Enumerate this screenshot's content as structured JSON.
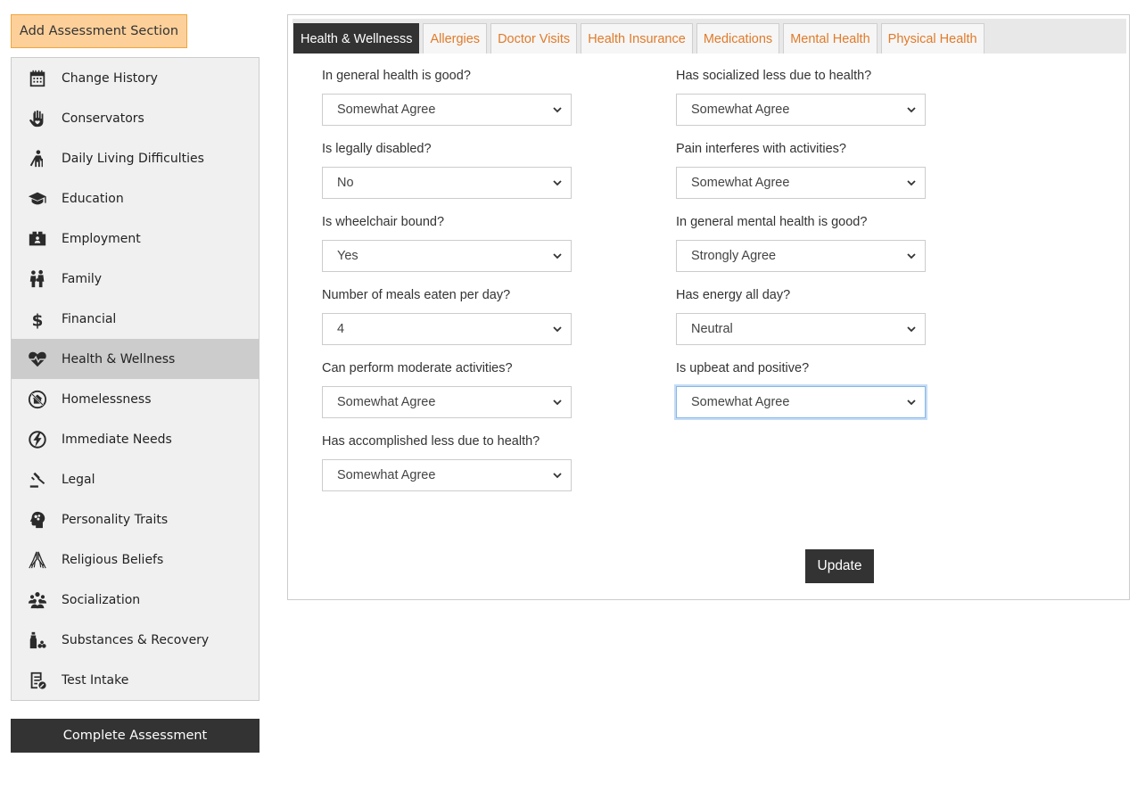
{
  "sidebar": {
    "add_section_label": "Add Assessment Section",
    "items": [
      {
        "label": "Change History",
        "icon": "calendar-icon"
      },
      {
        "label": "Conservators",
        "icon": "hand-heart-icon"
      },
      {
        "label": "Daily Living Difficulties",
        "icon": "person-cane-icon"
      },
      {
        "label": "Education",
        "icon": "graduation-cap-icon"
      },
      {
        "label": "Employment",
        "icon": "id-badge-icon"
      },
      {
        "label": "Family",
        "icon": "family-icon"
      },
      {
        "label": "Financial",
        "icon": "dollar-icon"
      },
      {
        "label": "Health & Wellness",
        "icon": "heartbeat-icon",
        "active": true
      },
      {
        "label": "Homelessness",
        "icon": "no-house-icon"
      },
      {
        "label": "Immediate Needs",
        "icon": "lightning-icon"
      },
      {
        "label": "Legal",
        "icon": "gavel-icon"
      },
      {
        "label": "Personality Traits",
        "icon": "brain-head-icon"
      },
      {
        "label": "Religious Beliefs",
        "icon": "praying-hands-icon"
      },
      {
        "label": "Socialization",
        "icon": "group-icon"
      },
      {
        "label": "Substances & Recovery",
        "icon": "bottle-pills-icon"
      },
      {
        "label": "Test Intake",
        "icon": "document-edit-icon"
      }
    ],
    "complete_label": "Complete Assessment"
  },
  "tabs": [
    {
      "label": "Health & Wellnesss",
      "active": true
    },
    {
      "label": "Allergies"
    },
    {
      "label": "Doctor Visits"
    },
    {
      "label": "Health Insurance"
    },
    {
      "label": "Medications"
    },
    {
      "label": "Mental Health"
    },
    {
      "label": "Physical Health"
    }
  ],
  "form": {
    "left": [
      {
        "label": "In general health is good?",
        "value": "Somewhat Agree"
      },
      {
        "label": "Is legally disabled?",
        "value": "No"
      },
      {
        "label": "Is wheelchair bound?",
        "value": "Yes"
      },
      {
        "label": "Number of meals eaten per day?",
        "value": "4"
      },
      {
        "label": "Can perform moderate activities?",
        "value": "Somewhat Agree"
      },
      {
        "label": "Has accomplished less due to health?",
        "value": "Somewhat Agree"
      }
    ],
    "right": [
      {
        "label": "Has socialized less due to health?",
        "value": "Somewhat Agree"
      },
      {
        "label": "Pain interferes with activities?",
        "value": "Somewhat Agree"
      },
      {
        "label": "In general mental health is good?",
        "value": "Strongly Agree"
      },
      {
        "label": "Has energy all day?",
        "value": "Neutral"
      },
      {
        "label": "Is upbeat and positive?",
        "value": "Somewhat Agree",
        "focused": true
      }
    ],
    "update_label": "Update"
  }
}
